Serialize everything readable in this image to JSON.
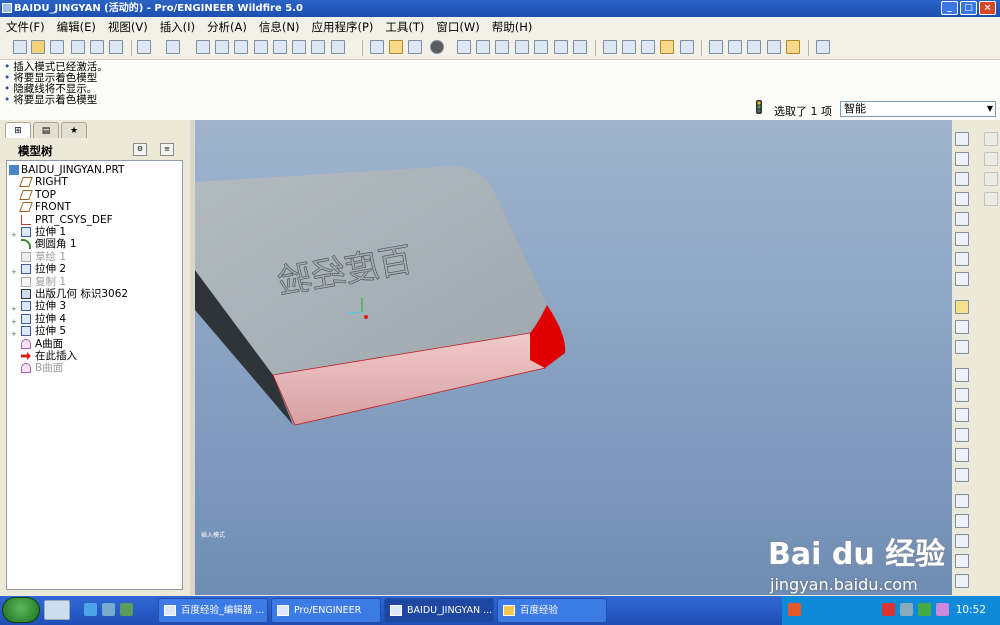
{
  "window": {
    "title": "BAIDU_JINGYAN (活动的) - Pro/ENGINEER Wildfire 5.0",
    "controls": [
      "_",
      "□",
      "×"
    ]
  },
  "menu": [
    "文件(F)",
    "编辑(E)",
    "视图(V)",
    "插入(I)",
    "分析(A)",
    "信息(N)",
    "应用程序(P)",
    "工具(T)",
    "窗口(W)",
    "帮助(H)"
  ],
  "messages": [
    "插入模式已经激活。",
    "将要显示着色模型",
    "隐藏线将不显示。",
    "将要显示着色模型"
  ],
  "selection": {
    "status": "选取了 1 项",
    "filter": "智能"
  },
  "model_tree": {
    "title": "模型树",
    "items": [
      {
        "label": "BAIDU_JINGYAN.PRT",
        "icon": "part-icon",
        "expand": "",
        "dim": false
      },
      {
        "label": "RIGHT",
        "icon": "datum-plane-icon",
        "expand": "",
        "dim": false
      },
      {
        "label": "TOP",
        "icon": "datum-plane-icon",
        "expand": "",
        "dim": false
      },
      {
        "label": "FRONT",
        "icon": "datum-plane-icon",
        "expand": "",
        "dim": false
      },
      {
        "label": "PRT_CSYS_DEF",
        "icon": "csys-icon",
        "expand": "",
        "dim": false
      },
      {
        "label": "拉伸 1",
        "icon": "extrude-icon",
        "expand": "+",
        "dim": false
      },
      {
        "label": "倒圆角 1",
        "icon": "round-icon",
        "expand": "",
        "dim": false
      },
      {
        "label": "草绘 1",
        "icon": "sketch-icon",
        "expand": "",
        "dim": true
      },
      {
        "label": "拉伸 2",
        "icon": "extrude-icon",
        "expand": "+",
        "dim": false
      },
      {
        "label": "复制 1",
        "icon": "copy-icon",
        "expand": "",
        "dim": true
      },
      {
        "label": "出版几何  标识3062",
        "icon": "publish-geom-icon",
        "expand": "",
        "dim": false
      },
      {
        "label": "拉伸 3",
        "icon": "extrude-icon",
        "expand": "+",
        "dim": false
      },
      {
        "label": "拉伸 4",
        "icon": "extrude-icon",
        "expand": "+",
        "dim": false
      },
      {
        "label": "拉伸 5",
        "icon": "extrude-icon",
        "expand": "+",
        "dim": false
      },
      {
        "label": "A曲面",
        "icon": "surface-icon",
        "expand": "",
        "dim": false
      },
      {
        "label": "在此插入",
        "icon": "insert-here-icon",
        "expand": "",
        "dim": false
      },
      {
        "label": "B曲面",
        "icon": "surface-icon",
        "expand": "",
        "dim": true
      }
    ]
  },
  "viewport": {
    "engraved_text": "百度经验",
    "mode_label": "插入模式"
  },
  "taskbar": {
    "tasks": [
      "百度经验_编辑器 ...",
      "Pro/ENGINEER",
      "BAIDU_JINGYAN ...",
      "百度经验"
    ],
    "clock": "10:52"
  },
  "watermark": {
    "brand": "Bai du 经验",
    "url": "jingyan.baidu.com"
  },
  "colors": {
    "title_bar": "#2b63c6",
    "viewport_top": "#9fb3cd",
    "viewport_bottom": "#6f8db4",
    "model_top": "#a9b2b6",
    "model_side": "#e8b8b8",
    "highlight": "#e10000",
    "taskbar": "#245edb"
  }
}
